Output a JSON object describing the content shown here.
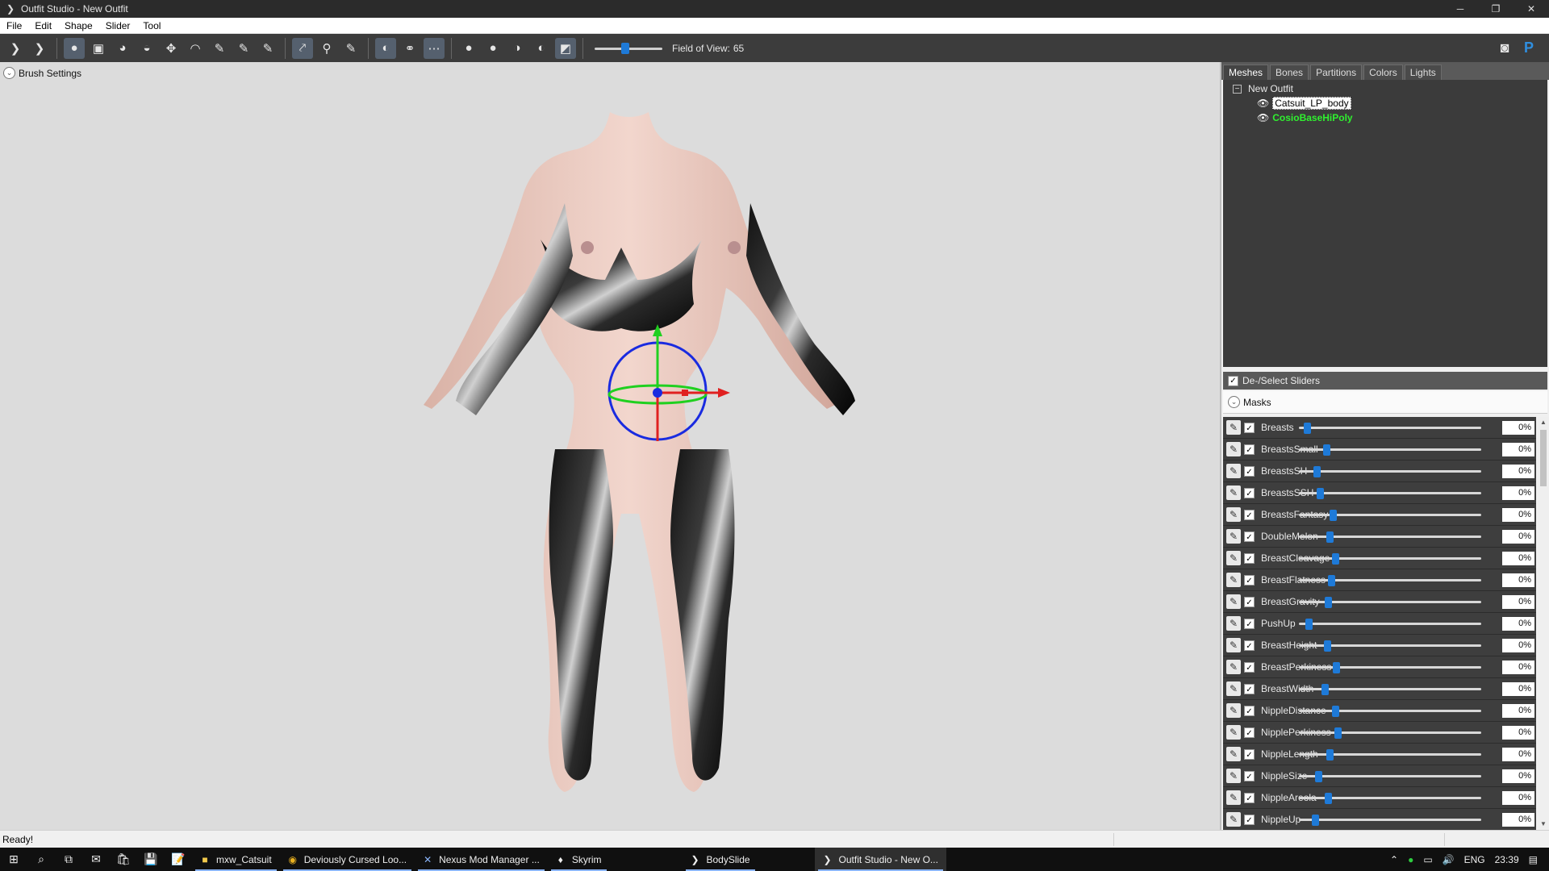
{
  "window": {
    "title": "Outfit Studio - New Outfit",
    "controls": [
      "minimize-icon",
      "restore-icon",
      "close-icon"
    ]
  },
  "menu": [
    "File",
    "Edit",
    "Shape",
    "Slider",
    "Tool"
  ],
  "toolbar": {
    "fov_label": "Field of View:",
    "fov_value": "65",
    "fov_level": 0.45
  },
  "viewport": {
    "brush_settings": "Brush Settings"
  },
  "panel": {
    "tabs": [
      "Meshes",
      "Bones",
      "Partitions",
      "Colors",
      "Lights"
    ],
    "active_tab": "Meshes",
    "tree_root": "New Outfit",
    "meshes": [
      {
        "name": "Catsuit_LP_body",
        "selected": true
      },
      {
        "name": "CosioBaseHiPoly",
        "color": "#2ff02f"
      }
    ],
    "deselect_label": "De-/Select Sliders",
    "masks_label": "Masks"
  },
  "sliders": [
    {
      "name": "Breasts",
      "value": "0%"
    },
    {
      "name": "BreastsSmall",
      "value": "0%"
    },
    {
      "name": "BreastsSH",
      "value": "0%"
    },
    {
      "name": "BreastsSSH",
      "value": "0%"
    },
    {
      "name": "BreastsFantasy",
      "value": "0%"
    },
    {
      "name": "DoubleMelon",
      "value": "0%"
    },
    {
      "name": "BreastCleavage",
      "value": "0%"
    },
    {
      "name": "BreastFlatness",
      "value": "0%"
    },
    {
      "name": "BreastGravity",
      "value": "0%"
    },
    {
      "name": "PushUp",
      "value": "0%"
    },
    {
      "name": "BreastHeight",
      "value": "0%"
    },
    {
      "name": "BreastPerkiness",
      "value": "0%"
    },
    {
      "name": "BreastWidth",
      "value": "0%"
    },
    {
      "name": "NippleDistance",
      "value": "0%"
    },
    {
      "name": "NipplePerkiness",
      "value": "0%"
    },
    {
      "name": "NippleLength",
      "value": "0%"
    },
    {
      "name": "NippleSize",
      "value": "0%"
    },
    {
      "name": "NippleAreola",
      "value": "0%"
    },
    {
      "name": "NippleUp",
      "value": "0%"
    }
  ],
  "status": {
    "text": "Ready!"
  },
  "taskbar": {
    "apps": [
      {
        "label": "mxw_Catsuit"
      },
      {
        "label": "Deviously Cursed Loo..."
      },
      {
        "label": "Nexus Mod Manager ..."
      },
      {
        "label": "Skyrim"
      },
      {
        "label": "BodySlide"
      },
      {
        "label": "Outfit Studio - New O..."
      }
    ],
    "lang": "ENG",
    "time": "23:39"
  },
  "colors": {
    "accent": "#1e7ad8",
    "toolbar_bg": "#3c3c3c",
    "viewport_bg": "#dcdcdc",
    "mesh_highlight": "#2ff02f"
  }
}
